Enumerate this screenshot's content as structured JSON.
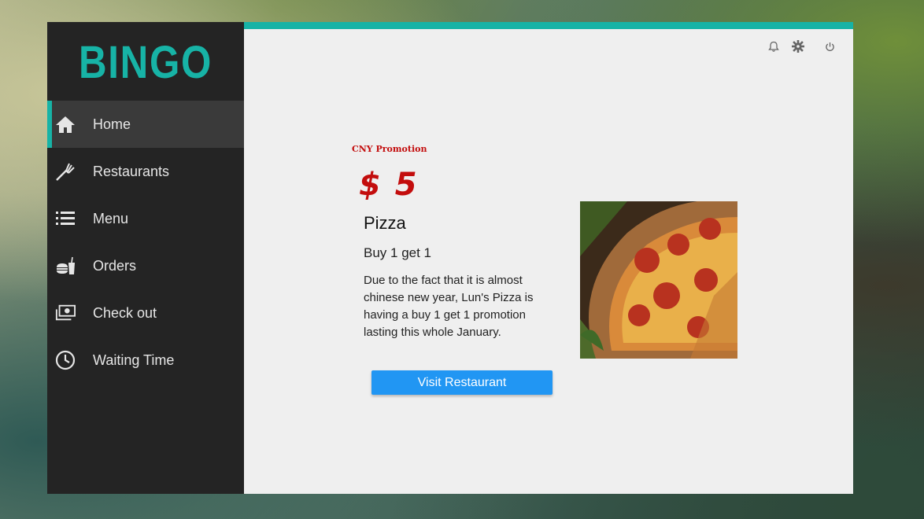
{
  "app": {
    "logo": "BINGO",
    "accent": "#17b3a6"
  },
  "sidebar": {
    "items": [
      {
        "label": "Home",
        "icon": "home-icon",
        "active": true
      },
      {
        "label": "Restaurants",
        "icon": "fork-icon",
        "active": false
      },
      {
        "label": "Menu",
        "icon": "list-icon",
        "active": false
      },
      {
        "label": "Orders",
        "icon": "food-drink-icon",
        "active": false
      },
      {
        "label": "Check out",
        "icon": "cash-icon",
        "active": false
      },
      {
        "label": "Waiting Time",
        "icon": "clock-icon",
        "active": false
      }
    ]
  },
  "topbar": {
    "icons": [
      "bell-icon",
      "gear-icon",
      "power-icon"
    ]
  },
  "promo": {
    "tag": "CNY Promotion",
    "price": "$ 5",
    "item": "Pizza",
    "deal": "Buy 1 get 1",
    "description": "Due to the fact that it is almost chinese new year, Lun's Pizza is having a buy 1 get 1 promotion lasting this whole January.",
    "button_label": "Visit Restaurant",
    "price_color": "#c30d0d",
    "button_color": "#2196f3"
  }
}
